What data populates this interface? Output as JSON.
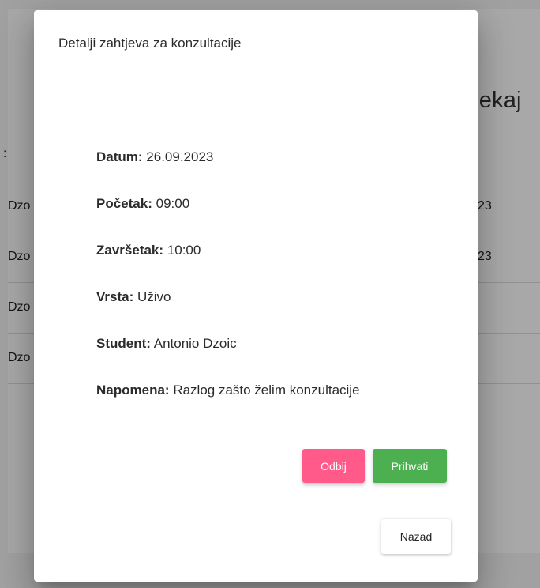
{
  "background": {
    "heading": "čekaj",
    "column_header": ":",
    "rows": [
      {
        "student": "Dzo",
        "date": "23"
      },
      {
        "student": "Dzo",
        "date": "23"
      },
      {
        "student": "Dzo",
        "date": ""
      },
      {
        "student": "Dzo",
        "date": ""
      }
    ]
  },
  "dialog": {
    "title": "Detalji zahtjeva za konzultacije",
    "details": [
      {
        "label": "Datum:",
        "value": "26.09.2023"
      },
      {
        "label": "Početak:",
        "value": "09:00"
      },
      {
        "label": "Završetak:",
        "value": "10:00"
      },
      {
        "label": "Vrsta:",
        "value": "Uživo"
      },
      {
        "label": "Student:",
        "value": "Antonio Dzoic"
      },
      {
        "label": "Napomena:",
        "value": "Razlog zašto želim konzultacije"
      }
    ],
    "buttons": {
      "reject": "Odbij",
      "accept": "Prihvati",
      "back": "Nazad"
    }
  },
  "colors": {
    "reject": "#ff5a8a",
    "accept": "#4caf50",
    "overlay": "rgba(0,0,0,0.34)"
  }
}
